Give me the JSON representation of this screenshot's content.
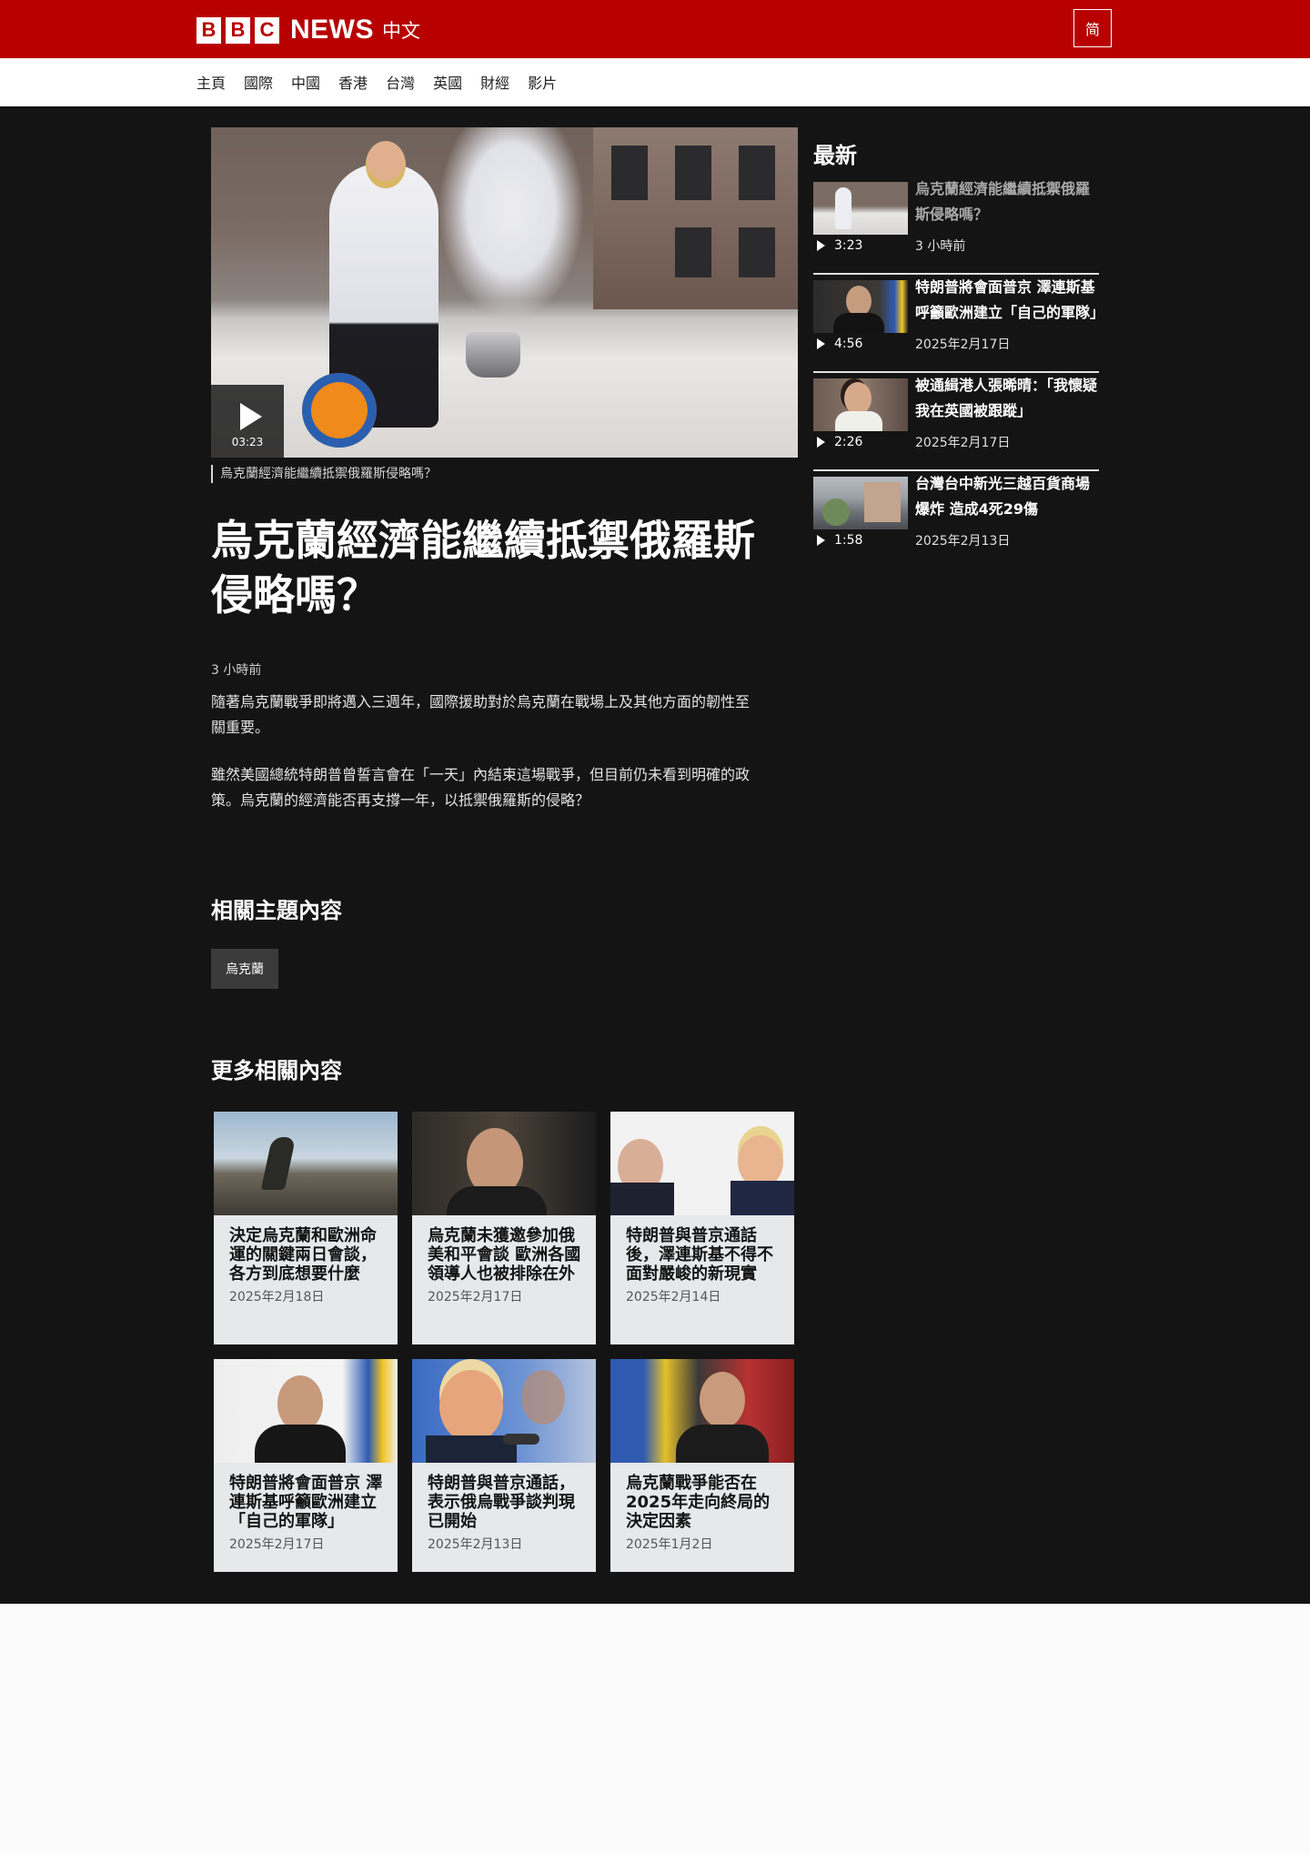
{
  "brand": {
    "letters": [
      "B",
      "B",
      "C"
    ],
    "news": "NEWS",
    "lang": "中文",
    "switch_label": "简"
  },
  "nav": [
    "主頁",
    "國際",
    "中國",
    "香港",
    "台灣",
    "英國",
    "財經",
    "影片"
  ],
  "hero": {
    "duration": "03:23",
    "caption": "烏克蘭經濟能繼續抵禦俄羅斯侵略嗎？"
  },
  "article": {
    "headline": "烏克蘭經濟能繼續抵禦俄羅斯侵略嗎？",
    "time": "3 小時前",
    "paragraphs": [
      "隨著烏克蘭戰爭即將邁入三週年，國際援助對於烏克蘭在戰場上及其他方面的韌性至關重要。",
      "雖然美國總統特朗普曾誓言會在「一天」內結束這場戰爭，但目前仍未看到明確的政策。烏克蘭的經濟能否再支撐一年，以抵禦俄羅斯的侵略？"
    ]
  },
  "topics": {
    "title": "相關主題內容",
    "tags": [
      "烏克蘭"
    ]
  },
  "related": {
    "title": "更多相關內容",
    "items": [
      {
        "title": "決定烏克蘭和歐洲命運的關鍵兩日會談，各方到底想要什麼",
        "date": "2025年2月18日"
      },
      {
        "title": "烏克蘭未獲邀參加俄美和平會談 歐洲各國領導人也被排除在外",
        "date": "2025年2月17日"
      },
      {
        "title": "特朗普與普京通話後，澤連斯基不得不面對嚴峻的新現實",
        "date": "2025年2月14日"
      },
      {
        "title": "特朗普將會面普京 澤連斯基呼籲歐洲建立「自己的軍隊」",
        "date": "2025年2月17日"
      },
      {
        "title": "特朗普與普京通話，表示俄烏戰爭談判現已開始",
        "date": "2025年2月13日"
      },
      {
        "title": "烏克蘭戰爭能否在2025年走向終局的決定因素",
        "date": "2025年1月2日"
      }
    ]
  },
  "latest": {
    "title": "最新",
    "items": [
      {
        "title": "烏克蘭經濟能繼續抵禦俄羅斯侵略嗎？",
        "duration": "3:23",
        "date": "3 小時前"
      },
      {
        "title": "特朗普將會面普京 澤連斯基呼籲歐洲建立「自己的軍隊」",
        "duration": "4:56",
        "date": "2025年2月17日"
      },
      {
        "title": "被通緝港人張晞晴：「我懷疑我在英國被跟蹤」",
        "duration": "2:26",
        "date": "2025年2月17日"
      },
      {
        "title": "台灣台中新光三越百貨商場爆炸 造成4死29傷",
        "duration": "1:58",
        "date": "2025年2月13日"
      }
    ]
  },
  "colors": {
    "brand_red": "#b80000",
    "page_dark": "#141414",
    "card_bg": "#e6e8ea"
  }
}
